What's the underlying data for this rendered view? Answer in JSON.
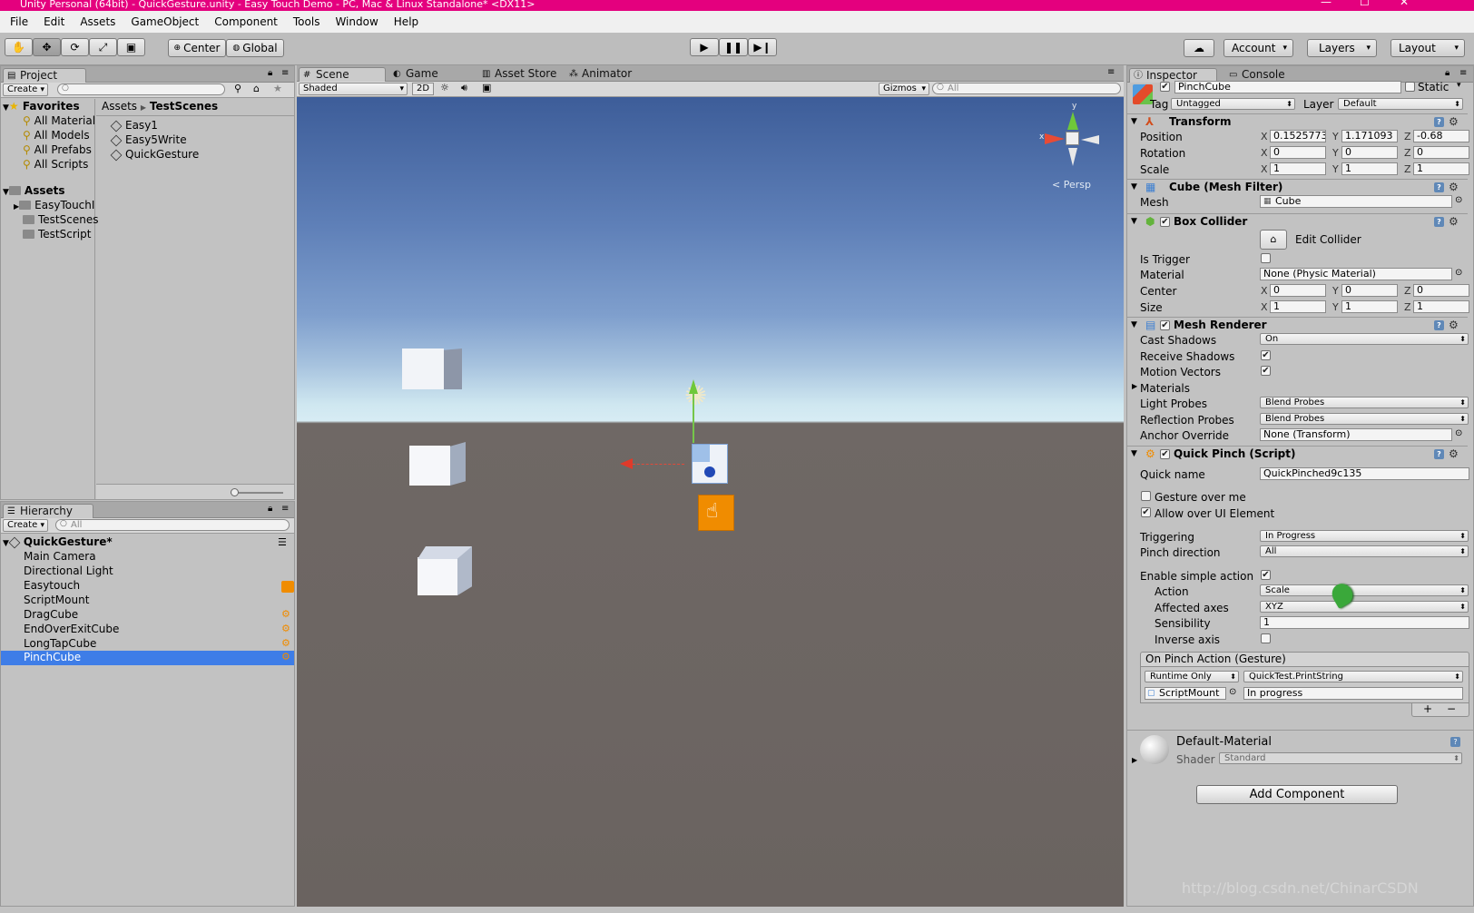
{
  "window": {
    "title": "Unity Personal (64bit) - QuickGesture.unity - Easy Touch Demo - PC, Mac & Linux Standalone* <DX11>"
  },
  "menu": [
    "File",
    "Edit",
    "Assets",
    "GameObject",
    "Component",
    "Tools",
    "Window",
    "Help"
  ],
  "toolbar": {
    "pivot_label": "Center",
    "space_label": "Global",
    "account_label": "Account",
    "layers_label": "Layers",
    "layout_label": "Layout"
  },
  "project": {
    "tab_label": "Project",
    "create_label": "Create",
    "favorites_label": "Favorites",
    "favorites": [
      "All Material",
      "All Models",
      "All Prefabs",
      "All Scripts"
    ],
    "assets_label": "Assets",
    "asset_folders": [
      "EasyTouchI",
      "TestScenes",
      "TestScript"
    ],
    "breadcrumb_root": "Assets",
    "breadcrumb_current": "TestScenes",
    "files": [
      "Easy1",
      "Easy5Write",
      "QuickGesture"
    ]
  },
  "hierarchy": {
    "tab_label": "Hierarchy",
    "create_label": "Create",
    "search_placeholder": "All",
    "scene_name": "QuickGesture*",
    "items": [
      "Main Camera",
      "Directional Light",
      "Easytouch",
      "ScriptMount",
      "DragCube",
      "EndOverExitCube",
      "LongTapCube",
      "PinchCube"
    ],
    "selected": "PinchCube"
  },
  "scene": {
    "tabs": [
      "Scene",
      "Game",
      "Asset Store",
      "Animator"
    ],
    "shading": "Shaded",
    "mode_2d": "2D",
    "gizmos_label": "Gizmos",
    "search_placeholder": "All",
    "persp_label": "< Persp"
  },
  "inspector": {
    "tab_label": "Inspector",
    "console_label": "Console",
    "object_name": "PinchCube",
    "static_label": "Static",
    "tag_label": "Tag",
    "tag_value": "Untagged",
    "layer_label": "Layer",
    "layer_value": "Default",
    "transform": {
      "title": "Transform",
      "position_label": "Position",
      "rotation_label": "Rotation",
      "scale_label": "Scale",
      "position": [
        "0.1525773",
        "1.171093",
        "-0.68"
      ],
      "rotation": [
        "0",
        "0",
        "0"
      ],
      "scale": [
        "1",
        "1",
        "1"
      ]
    },
    "mesh_filter": {
      "title": "Cube (Mesh Filter)",
      "mesh_label": "Mesh",
      "mesh_value": "Cube"
    },
    "box_collider": {
      "title": "Box Collider",
      "edit_label": "Edit Collider",
      "is_trigger_label": "Is Trigger",
      "material_label": "Material",
      "material_value": "None (Physic Material)",
      "center_label": "Center",
      "center": [
        "0",
        "0",
        "0"
      ],
      "size_label": "Size",
      "size": [
        "1",
        "1",
        "1"
      ]
    },
    "mesh_renderer": {
      "title": "Mesh Renderer",
      "cast_shadows_label": "Cast Shadows",
      "cast_shadows_value": "On",
      "receive_shadows_label": "Receive Shadows",
      "motion_vectors_label": "Motion Vectors",
      "materials_label": "Materials",
      "light_probes_label": "Light Probes",
      "light_probes_value": "Blend Probes",
      "reflection_probes_label": "Reflection Probes",
      "reflection_probes_value": "Blend Probes",
      "anchor_override_label": "Anchor Override",
      "anchor_override_value": "None (Transform)"
    },
    "quick_pinch": {
      "title": "Quick Pinch (Script)",
      "quick_name_label": "Quick name",
      "quick_name_value": "QuickPinched9c135",
      "gesture_over_me_label": "Gesture over me",
      "allow_over_ui_label": "Allow over UI Element",
      "triggering_label": "Triggering",
      "triggering_value": "In Progress",
      "pinch_direction_label": "Pinch direction",
      "pinch_direction_value": "All",
      "enable_simple_label": "Enable simple action",
      "action_label": "Action",
      "action_value": "Scale",
      "affected_axes_label": "Affected axes",
      "affected_axes_value": "XYZ",
      "sensibility_label": "Sensibility",
      "sensibility_value": "1",
      "inverse_axis_label": "Inverse axis",
      "event_title": "On Pinch Action (Gesture)",
      "runtime_value": "Runtime Only",
      "function_value": "QuickTest.PrintString",
      "target_value": "ScriptMount",
      "argument_value": "In progress"
    },
    "material": {
      "name": "Default-Material",
      "shader_label": "Shader",
      "shader_value": "Standard"
    },
    "add_component_label": "Add Component"
  },
  "watermark": "http://blog.csdn.net/ChinarCSDN"
}
